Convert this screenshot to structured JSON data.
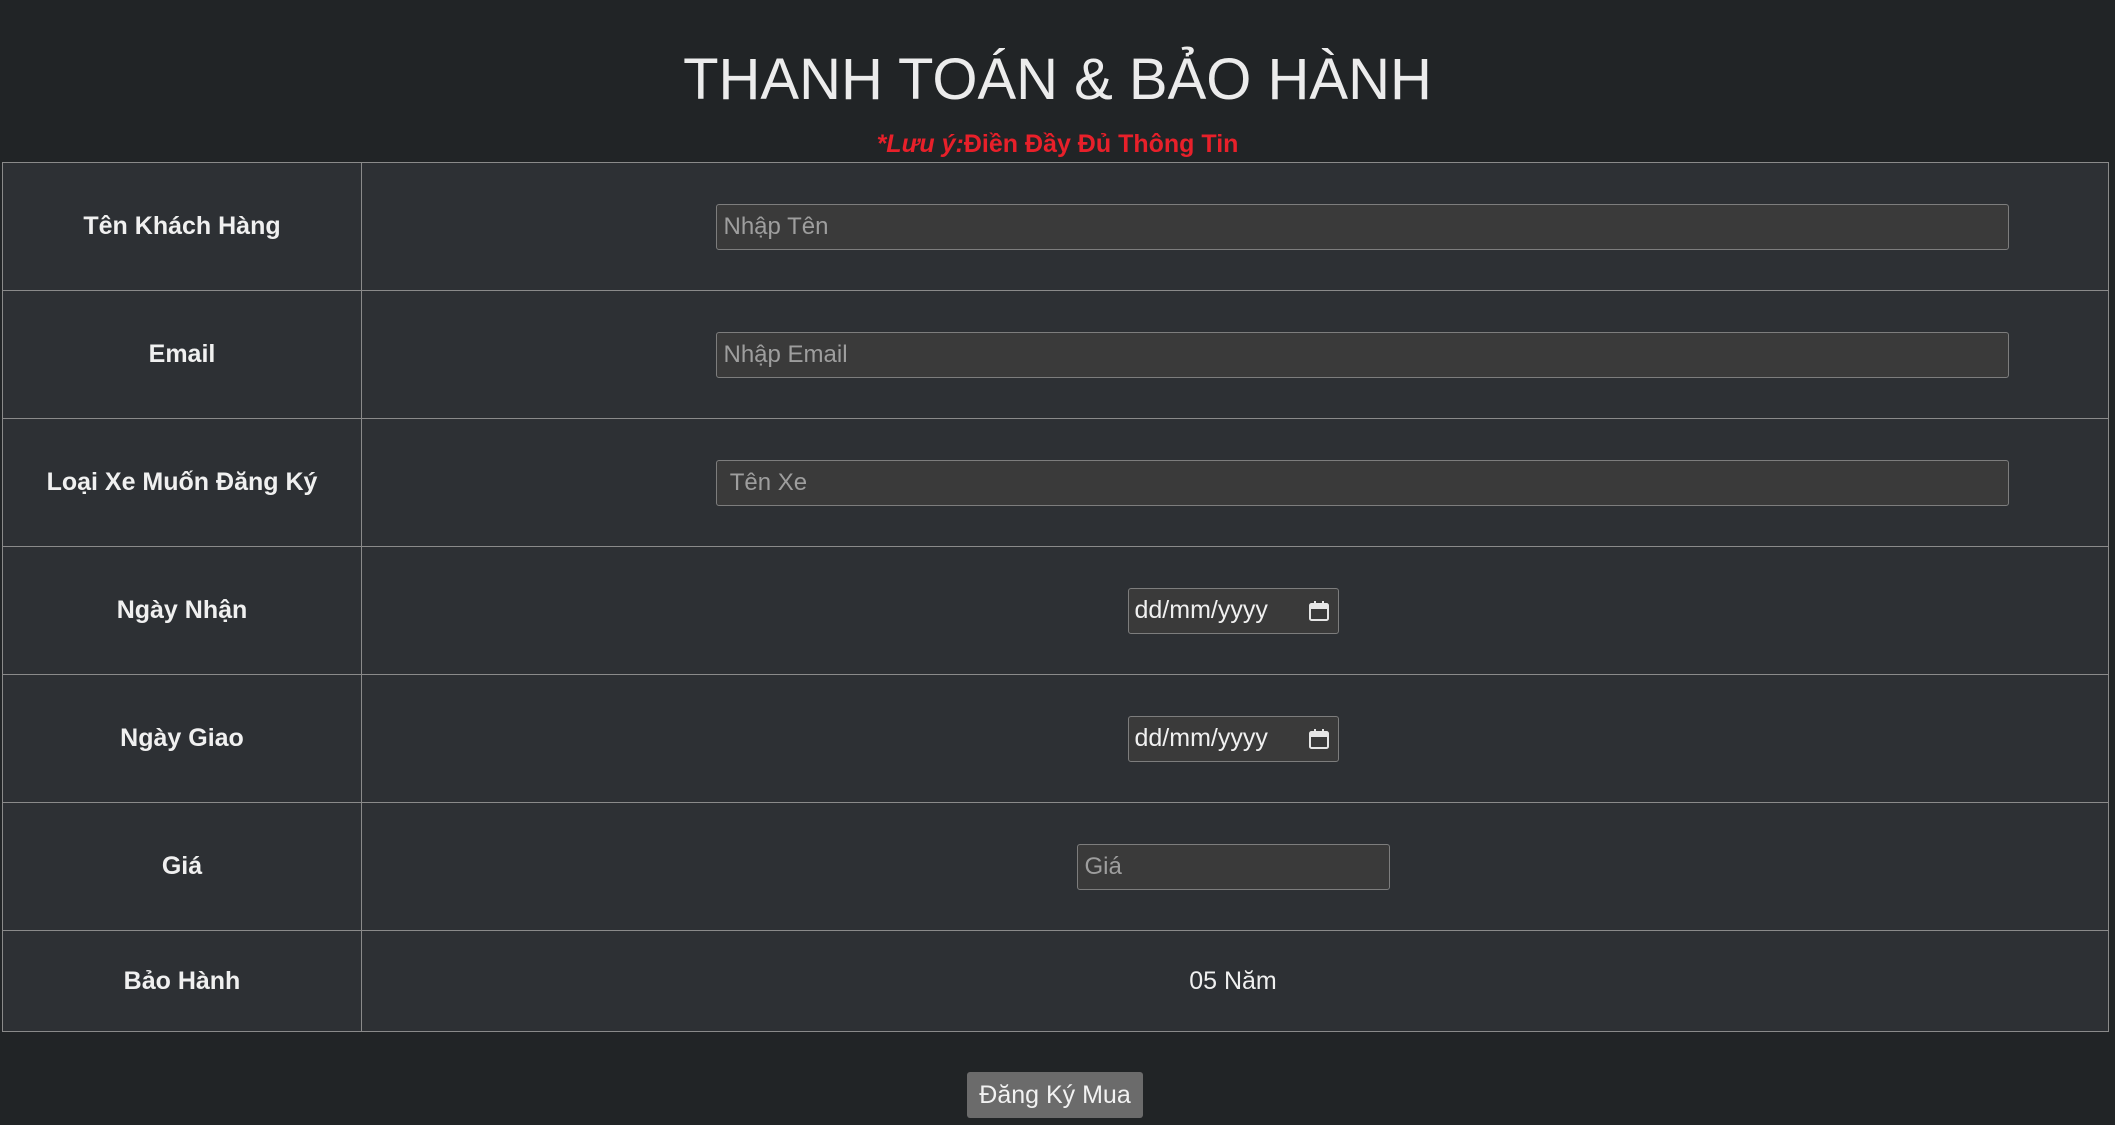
{
  "header": {
    "title": "THANH TOÁN & BẢO HÀNH",
    "notice_prefix": "*Lưu ý:",
    "notice_text": "Điền Đầy Đủ Thông Tin"
  },
  "form": {
    "customer_name": {
      "label": "Tên Khách Hàng",
      "placeholder": "Nhập Tên",
      "value": ""
    },
    "email": {
      "label": "Email",
      "placeholder": "Nhập Email",
      "value": ""
    },
    "vehicle": {
      "label": "Loại Xe Muốn Đăng Ký",
      "placeholder": " Tên Xe",
      "value": ""
    },
    "receive_date": {
      "label": "Ngày Nhận",
      "value_text": "dd/mm/yyyy",
      "icon": "calendar-icon"
    },
    "delivery_date": {
      "label": "Ngày Giao",
      "value_text": "dd/mm/yyyy",
      "icon": "calendar-icon"
    },
    "price": {
      "label": "Giá",
      "placeholder": "Giá",
      "value": ""
    },
    "warranty": {
      "label": "Bảo Hành",
      "value": "05 Năm"
    }
  },
  "actions": {
    "submit_label": "Đăng Ký Mua"
  },
  "colors": {
    "background": "#212426",
    "table_background": "#2d3034",
    "notice": "#e8202a",
    "button": "#6b6b6b"
  }
}
